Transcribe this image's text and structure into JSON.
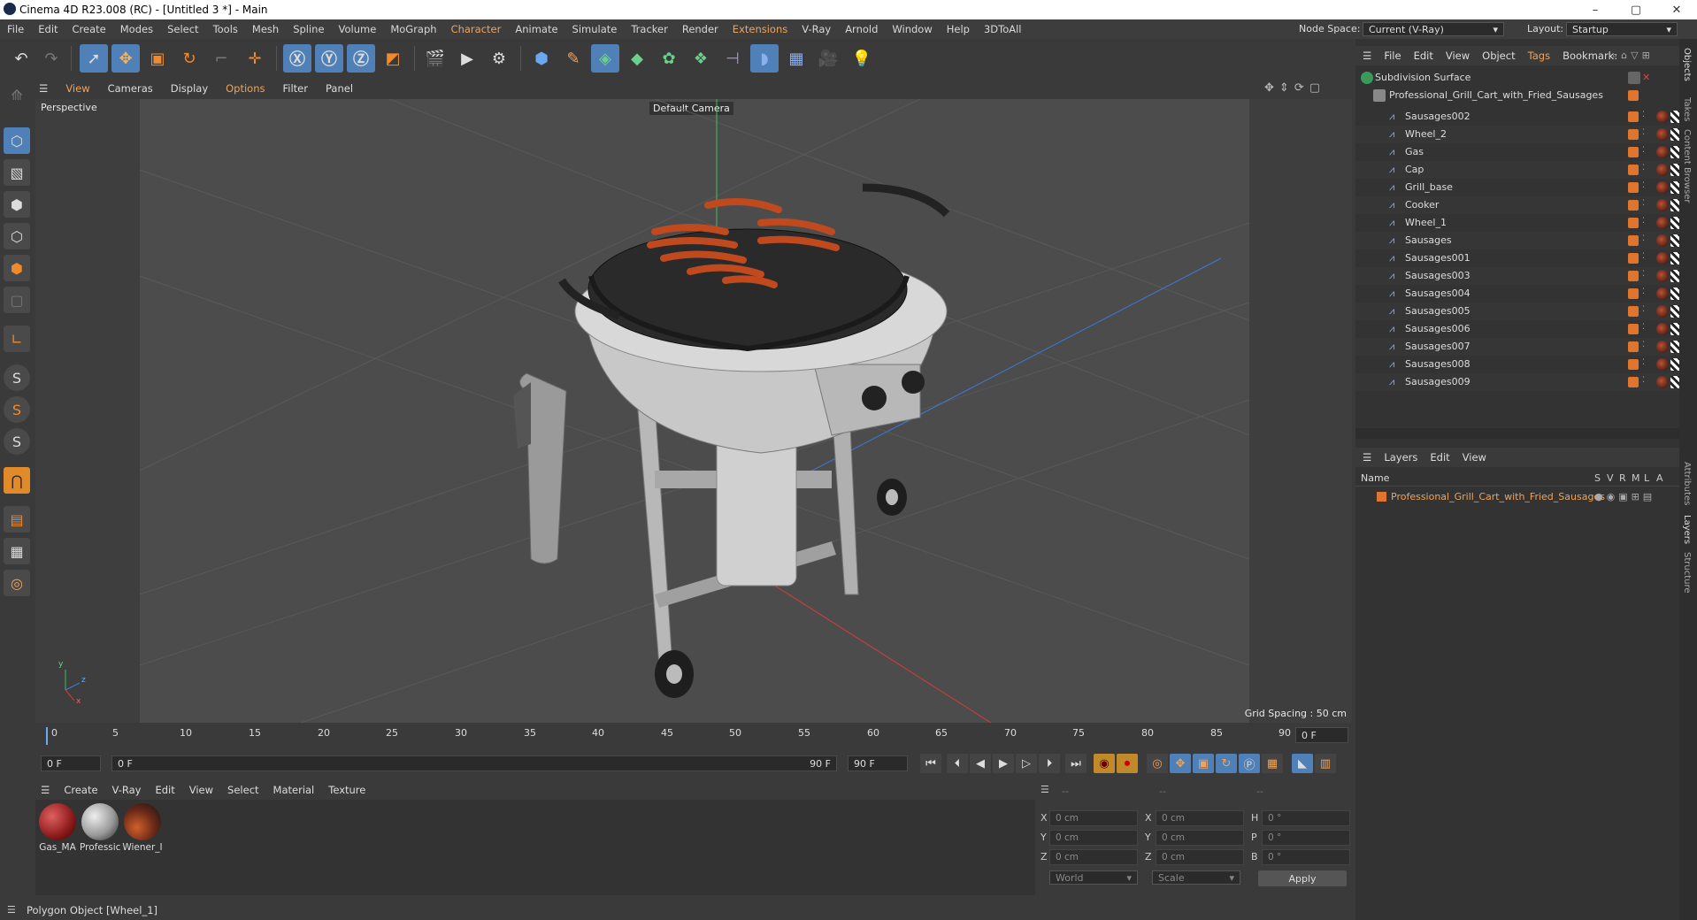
{
  "window": {
    "title": "Cinema 4D R23.008 (RC) - [Untitled 3 *] - Main",
    "minimize": "–",
    "maximize": "▢",
    "close": "✕"
  },
  "menu": {
    "items": [
      "File",
      "Edit",
      "Create",
      "Modes",
      "Select",
      "Tools",
      "Mesh",
      "Spline",
      "Volume",
      "MoGraph",
      "Character",
      "Animate",
      "Simulate",
      "Tracker",
      "Render",
      "Extensions",
      "V-Ray",
      "Arnold",
      "Window",
      "Help",
      "3DToAll"
    ],
    "orange_items": [
      "Character",
      "Extensions"
    ],
    "node_space_label": "Node Space:",
    "node_space_value": "Current (V-Ray)",
    "layout_label": "Layout:",
    "layout_value": "Startup"
  },
  "viewport": {
    "menu": [
      "View",
      "Cameras",
      "Display",
      "Options",
      "Filter",
      "Panel"
    ],
    "view_name": "Perspective",
    "camera": "Default Camera",
    "grid_spacing": "Grid Spacing : 50 cm",
    "axis_y": "y",
    "axis_z": "z",
    "axis_x": "x"
  },
  "timeline": {
    "ticks": [
      "0",
      "5",
      "10",
      "15",
      "20",
      "25",
      "30",
      "35",
      "40",
      "45",
      "50",
      "55",
      "60",
      "65",
      "70",
      "75",
      "80",
      "85",
      "90"
    ],
    "current_frame": "0 F"
  },
  "transport": {
    "start": "0 F",
    "range_start": "0 F",
    "range_end": "90 F",
    "end": "90 F"
  },
  "materials": {
    "menu": [
      "Create",
      "V-Ray",
      "Edit",
      "View",
      "Select",
      "Material",
      "Texture"
    ],
    "items": [
      {
        "label": "Gas_MA",
        "color": "#8a1a1a"
      },
      {
        "label": "Professic",
        "color": "#9a9a9a"
      },
      {
        "label": "Wiener_I",
        "color": "#6b2a18"
      }
    ]
  },
  "coords": {
    "rows": [
      {
        "l1": "X",
        "v1": "0 cm",
        "l2": "X",
        "v2": "0 cm",
        "l3": "H",
        "v3": "0 °"
      },
      {
        "l1": "Y",
        "v1": "0 cm",
        "l2": "Y",
        "v2": "0 cm",
        "l3": "P",
        "v3": "0 °"
      },
      {
        "l1": "Z",
        "v1": "0 cm",
        "l2": "Z",
        "v2": "0 cm",
        "l3": "B",
        "v3": "0 °"
      }
    ],
    "dash1": "--",
    "dash2": "--",
    "dash3": "--",
    "mode": "World",
    "scale": "Scale",
    "apply": "Apply"
  },
  "status": {
    "text": "Polygon Object [Wheel_1]"
  },
  "objects": {
    "menu": [
      "File",
      "Edit",
      "View",
      "Object",
      "Tags",
      "Bookmark:"
    ],
    "root": "Subdivision Surface",
    "group": "Professional_Grill_Cart_with_Fried_Sausages",
    "children": [
      "Sausages002",
      "Wheel_2",
      "Gas",
      "Cap",
      "Grill_base",
      "Cooker",
      "Wheel_1",
      "Sausages",
      "Sausages001",
      "Sausages003",
      "Sausages004",
      "Sausages005",
      "Sausages006",
      "Sausages007",
      "Sausages008",
      "Sausages009"
    ]
  },
  "layers": {
    "menu": [
      "Layers",
      "Edit",
      "View"
    ],
    "col_name": "Name",
    "cols": [
      "S",
      "V",
      "R",
      "M",
      "L",
      "A"
    ],
    "row": "Professional_Grill_Cart_with_Fried_Sausages"
  },
  "side_tabs": [
    "Objects",
    "Takes",
    "Content Browser",
    "Attributes",
    "Layers",
    "Structure"
  ]
}
